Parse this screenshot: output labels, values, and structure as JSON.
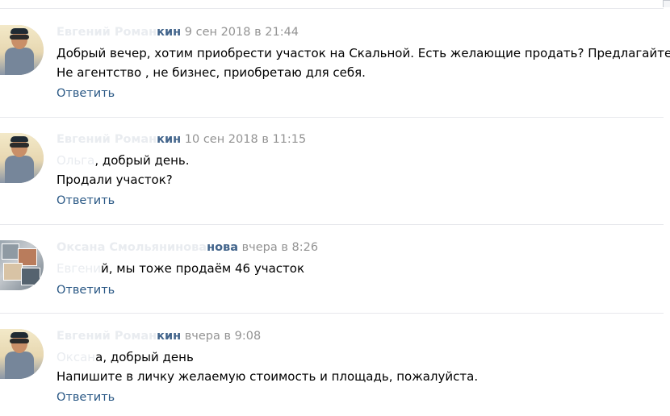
{
  "comments": [
    {
      "author_hidden": "Евгений Роман",
      "author_visible": "кин",
      "date": "9 сен 2018 в 21:44",
      "lines": [
        "Добрый вечер, хотим приобрести участок на Скальной. Есть желающие продать? Предлагайте!",
        "Не агентство , не бизнес, приобретаю для себя."
      ],
      "reply": "Ответить"
    },
    {
      "author_hidden": "Евгений Роман",
      "author_visible": "кин",
      "date": "10 сен 2018 в 11:15",
      "mention_hidden": "Ольга",
      "line1_rest": ", добрый день.",
      "line2": "Продали участок?",
      "reply": "Ответить"
    },
    {
      "author_hidden": "Оксана Смольянинова",
      "author_visible": "нова",
      "date": "вчера в 8:26",
      "mention_hidden": "Евгени",
      "line1_rest": "й, мы тоже продаём 46 участок",
      "reply": "Ответить"
    },
    {
      "author_hidden": "Евгений Роман",
      "author_visible": "кин",
      "date": "вчера в 9:08",
      "mention_hidden": "Оксан",
      "line1_rest": "а, добрый день",
      "line2": "Напишите в личку желаемую стоимость и площадь, пожалуйста.",
      "reply": "Ответить"
    }
  ]
}
